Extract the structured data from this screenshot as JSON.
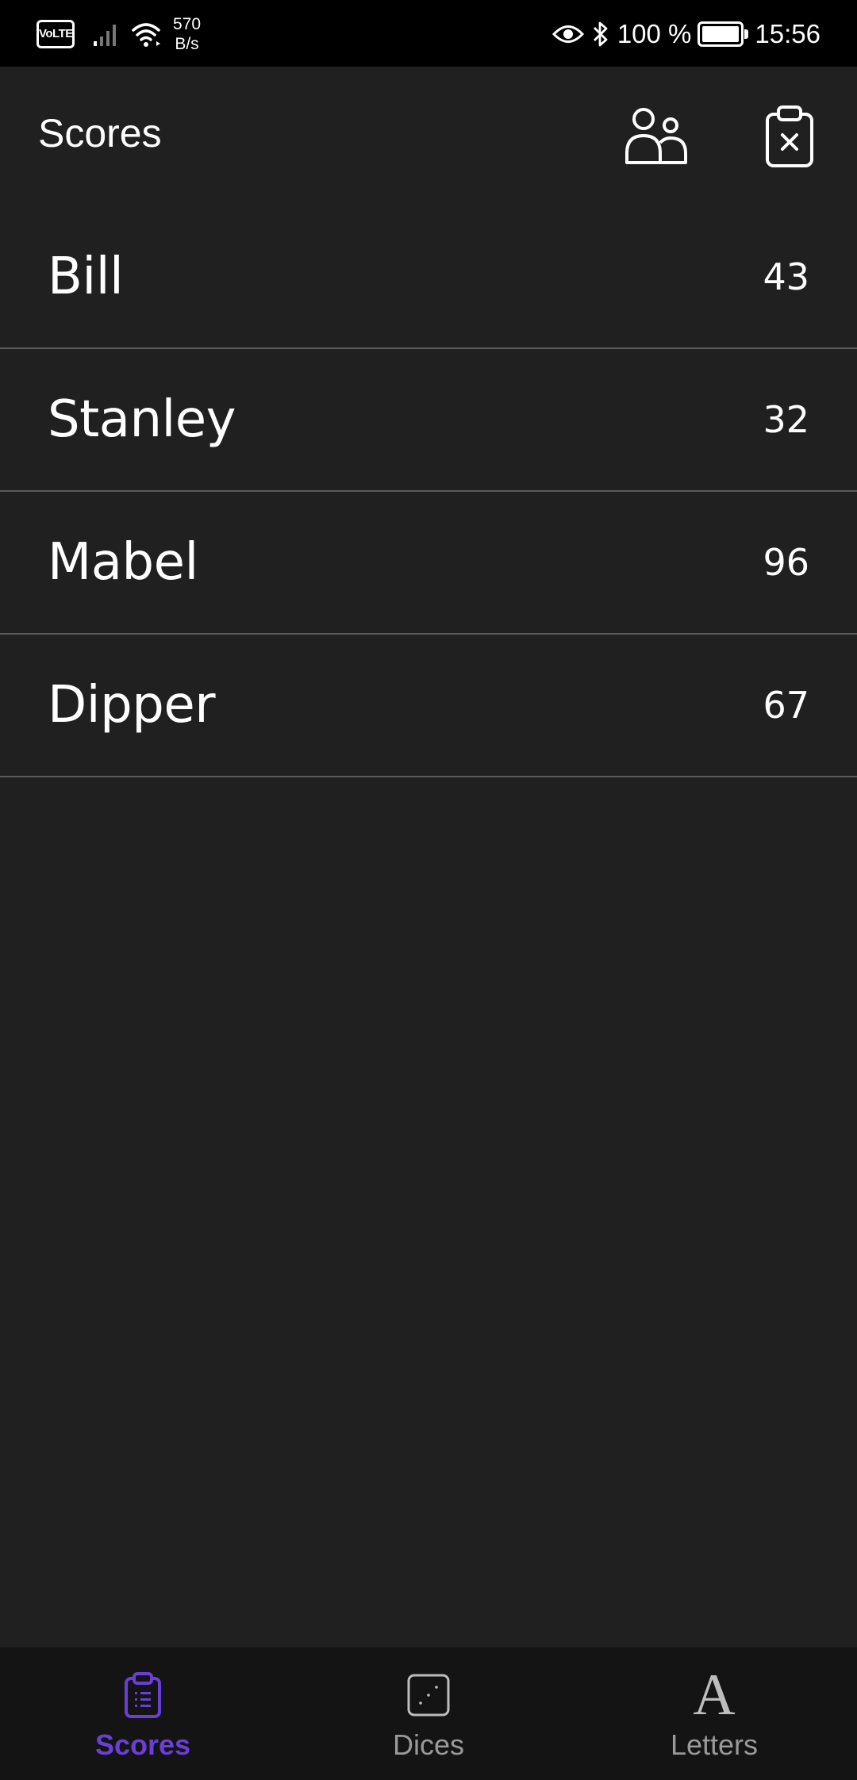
{
  "status_bar": {
    "volte": "VoLTE",
    "net_speed_value": "570",
    "net_speed_unit": "B/s",
    "battery_percent": "100 %",
    "time": "15:56"
  },
  "app_bar": {
    "title": "Scores",
    "players_icon": "people-icon",
    "clear_icon": "clipboard-x-icon"
  },
  "scores": [
    {
      "name": "Bill",
      "score": "43"
    },
    {
      "name": "Stanley",
      "score": "32"
    },
    {
      "name": "Mabel",
      "score": "96"
    },
    {
      "name": "Dipper",
      "score": "67"
    }
  ],
  "bottom_nav": {
    "items": [
      {
        "label": "Scores",
        "icon": "clipboard-list-icon",
        "active": true
      },
      {
        "label": "Dices",
        "icon": "dice-icon",
        "active": false
      },
      {
        "label": "Letters",
        "icon": "letter-a-icon",
        "active": false
      }
    ],
    "letter_glyph": "A"
  },
  "colors": {
    "background": "#202020",
    "nav_background": "#141414",
    "accent": "#6a3fd8",
    "divider": "#5a5a5a"
  }
}
